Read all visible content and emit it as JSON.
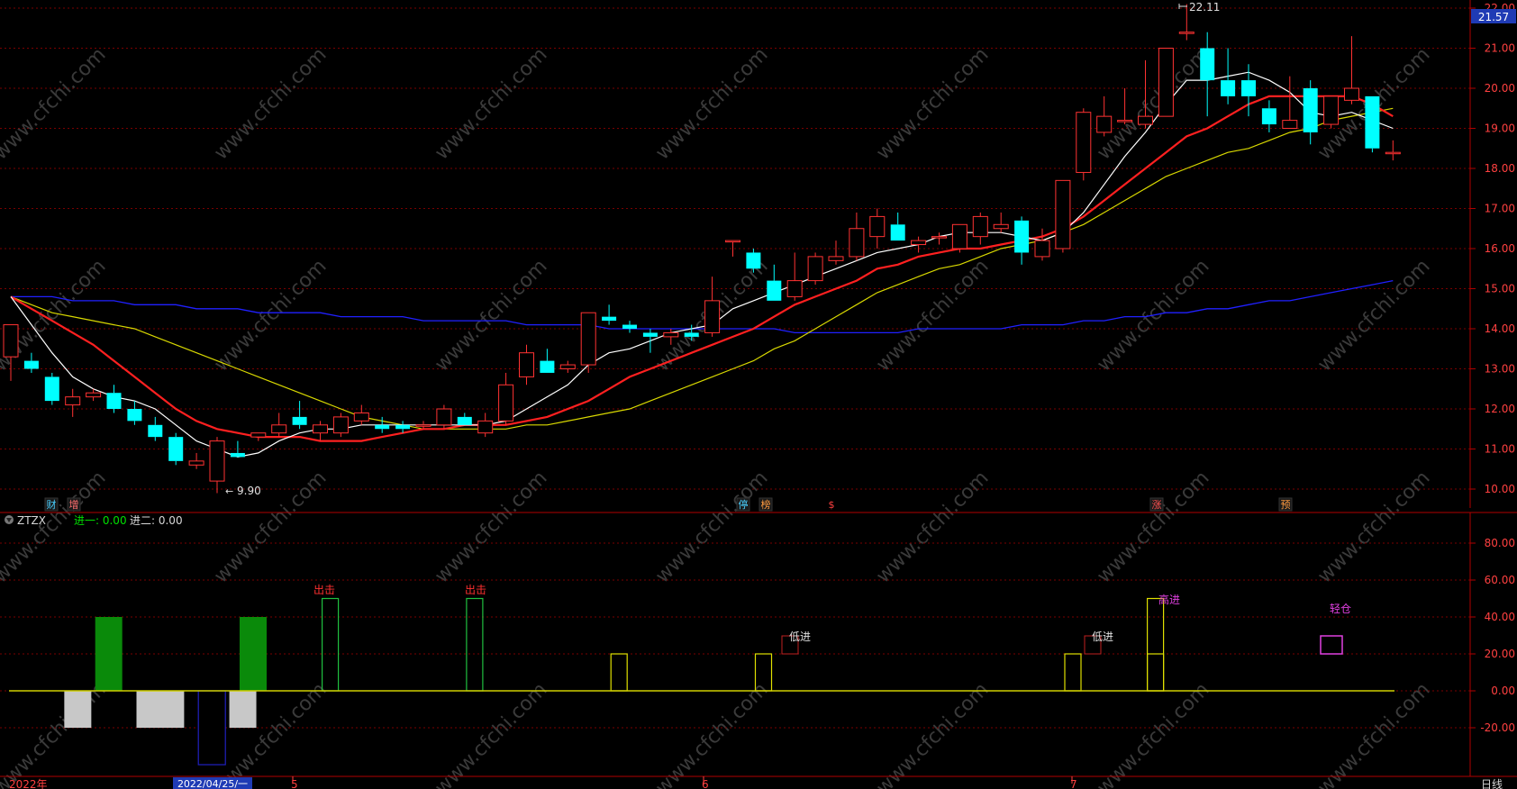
{
  "main_chart": {
    "price_axis_ticks": [
      "22.00",
      "21.00",
      "20.00",
      "19.00",
      "18.00",
      "17.00",
      "16.00",
      "15.00",
      "14.00",
      "13.00",
      "12.00",
      "11.00",
      "10.00"
    ],
    "current_price": "21.57",
    "high_marker": "22.11",
    "low_marker": "9.90",
    "event_tags": [
      "财",
      "增",
      "停",
      "榜",
      "$",
      "涨",
      "预"
    ]
  },
  "indicator": {
    "name": "ZTZX",
    "legend_1": "进一: 0.00",
    "legend_2": "进二: 0.00",
    "axis_ticks": [
      "80.00",
      "60.00",
      "40.00",
      "20.00",
      "0.00",
      "-20.00"
    ],
    "annotations": [
      "出击",
      "出击",
      "低进",
      "低进",
      "高进",
      "轻仓"
    ]
  },
  "time_axis": {
    "labels": [
      "2022年",
      "5",
      "6",
      "7"
    ],
    "cursor_date": "2022/04/25/一",
    "period": "日线"
  },
  "watermark": "www.cfchi.com",
  "colors": {
    "up": "#ff3232",
    "down": "#00ffff",
    "ma5": "#ffffff",
    "ma10": "#ff2020",
    "ma20": "#d8d800",
    "ma60": "#2020ff",
    "grid": "#7a0000"
  },
  "chart_data": {
    "type": "candlestick",
    "price_range": [
      9.7,
      22.1
    ],
    "candles": [
      {
        "o": 13.3,
        "h": 14.1,
        "l": 12.7,
        "c": 14.1
      },
      {
        "o": 13.2,
        "h": 13.4,
        "l": 12.9,
        "c": 13.0
      },
      {
        "o": 12.8,
        "h": 12.9,
        "l": 12.1,
        "c": 12.2
      },
      {
        "o": 12.1,
        "h": 12.5,
        "l": 11.8,
        "c": 12.3
      },
      {
        "o": 12.3,
        "h": 12.5,
        "l": 12.2,
        "c": 12.4
      },
      {
        "o": 12.4,
        "h": 12.6,
        "l": 11.9,
        "c": 12.0
      },
      {
        "o": 12.0,
        "h": 12.2,
        "l": 11.6,
        "c": 11.7
      },
      {
        "o": 11.6,
        "h": 11.8,
        "l": 11.2,
        "c": 11.3
      },
      {
        "o": 11.3,
        "h": 11.4,
        "l": 10.6,
        "c": 10.7
      },
      {
        "o": 10.6,
        "h": 10.9,
        "l": 10.5,
        "c": 10.7
      },
      {
        "o": 10.2,
        "h": 11.3,
        "l": 9.9,
        "c": 11.2
      },
      {
        "o": 10.9,
        "h": 11.2,
        "l": 10.8,
        "c": 10.8
      },
      {
        "o": 11.3,
        "h": 11.4,
        "l": 11.2,
        "c": 11.4
      },
      {
        "o": 11.4,
        "h": 11.9,
        "l": 11.3,
        "c": 11.6
      },
      {
        "o": 11.8,
        "h": 12.2,
        "l": 11.5,
        "c": 11.6
      },
      {
        "o": 11.4,
        "h": 11.7,
        "l": 11.2,
        "c": 11.6
      },
      {
        "o": 11.4,
        "h": 11.9,
        "l": 11.3,
        "c": 11.8
      },
      {
        "o": 11.7,
        "h": 12.1,
        "l": 11.6,
        "c": 11.9
      },
      {
        "o": 11.6,
        "h": 11.8,
        "l": 11.4,
        "c": 11.5
      },
      {
        "o": 11.6,
        "h": 11.7,
        "l": 11.4,
        "c": 11.5
      },
      {
        "o": 11.6,
        "h": 11.7,
        "l": 11.5,
        "c": 11.6
      },
      {
        "o": 11.6,
        "h": 12.1,
        "l": 11.5,
        "c": 12.0
      },
      {
        "o": 11.8,
        "h": 11.9,
        "l": 11.6,
        "c": 11.6
      },
      {
        "o": 11.4,
        "h": 11.9,
        "l": 11.3,
        "c": 11.7
      },
      {
        "o": 11.7,
        "h": 12.9,
        "l": 11.6,
        "c": 12.6
      },
      {
        "o": 12.8,
        "h": 13.6,
        "l": 12.6,
        "c": 13.4
      },
      {
        "o": 13.2,
        "h": 13.5,
        "l": 12.9,
        "c": 12.9
      },
      {
        "o": 13.0,
        "h": 13.2,
        "l": 12.9,
        "c": 13.1
      },
      {
        "o": 13.1,
        "h": 14.4,
        "l": 12.9,
        "c": 14.4
      },
      {
        "o": 14.3,
        "h": 14.6,
        "l": 14.1,
        "c": 14.2
      },
      {
        "o": 14.1,
        "h": 14.2,
        "l": 13.9,
        "c": 14.0
      },
      {
        "o": 13.9,
        "h": 14.0,
        "l": 13.4,
        "c": 13.8
      },
      {
        "o": 13.8,
        "h": 14.0,
        "l": 13.6,
        "c": 13.9
      },
      {
        "o": 13.9,
        "h": 14.1,
        "l": 13.7,
        "c": 13.8
      },
      {
        "o": 13.9,
        "h": 15.3,
        "l": 13.8,
        "c": 14.7
      },
      {
        "o": 16.2,
        "h": 16.2,
        "l": 15.8,
        "c": 16.2
      },
      {
        "o": 15.9,
        "h": 16.0,
        "l": 15.4,
        "c": 15.5
      },
      {
        "o": 15.2,
        "h": 15.6,
        "l": 14.7,
        "c": 14.7
      },
      {
        "o": 14.8,
        "h": 15.9,
        "l": 14.7,
        "c": 15.2
      },
      {
        "o": 15.2,
        "h": 15.9,
        "l": 15.1,
        "c": 15.8
      },
      {
        "o": 15.7,
        "h": 16.2,
        "l": 15.6,
        "c": 15.8
      },
      {
        "o": 15.8,
        "h": 16.9,
        "l": 15.7,
        "c": 16.5
      },
      {
        "o": 16.3,
        "h": 17.0,
        "l": 16.0,
        "c": 16.8
      },
      {
        "o": 16.6,
        "h": 16.9,
        "l": 16.2,
        "c": 16.2
      },
      {
        "o": 16.1,
        "h": 16.3,
        "l": 15.9,
        "c": 16.2
      },
      {
        "o": 16.3,
        "h": 16.4,
        "l": 16.1,
        "c": 16.3
      },
      {
        "o": 16.0,
        "h": 16.6,
        "l": 15.9,
        "c": 16.6
      },
      {
        "o": 16.3,
        "h": 16.9,
        "l": 16.1,
        "c": 16.8
      },
      {
        "o": 16.5,
        "h": 16.9,
        "l": 16.4,
        "c": 16.6
      },
      {
        "o": 16.7,
        "h": 16.8,
        "l": 15.6,
        "c": 15.9
      },
      {
        "o": 15.8,
        "h": 16.5,
        "l": 15.7,
        "c": 16.2
      },
      {
        "o": 16.0,
        "h": 17.7,
        "l": 15.9,
        "c": 17.7
      },
      {
        "o": 17.9,
        "h": 19.5,
        "l": 17.7,
        "c": 19.4
      },
      {
        "o": 18.9,
        "h": 19.8,
        "l": 18.8,
        "c": 19.3
      },
      {
        "o": 19.2,
        "h": 20.0,
        "l": 19.1,
        "c": 19.2
      },
      {
        "o": 19.1,
        "h": 20.7,
        "l": 19.0,
        "c": 19.3
      },
      {
        "o": 19.3,
        "h": 21.0,
        "l": 19.3,
        "c": 21.0
      },
      {
        "o": 21.4,
        "h": 22.1,
        "l": 21.2,
        "c": 21.4
      },
      {
        "o": 21.0,
        "h": 21.4,
        "l": 19.3,
        "c": 20.2
      },
      {
        "o": 20.2,
        "h": 21.0,
        "l": 19.6,
        "c": 19.8
      },
      {
        "o": 20.2,
        "h": 20.6,
        "l": 19.3,
        "c": 19.8
      },
      {
        "o": 19.5,
        "h": 19.7,
        "l": 18.9,
        "c": 19.1
      },
      {
        "o": 19.0,
        "h": 20.3,
        "l": 19.0,
        "c": 19.2
      },
      {
        "o": 20.0,
        "h": 20.2,
        "l": 18.6,
        "c": 18.9
      },
      {
        "o": 19.1,
        "h": 19.8,
        "l": 19.0,
        "c": 19.8
      },
      {
        "o": 19.7,
        "h": 21.3,
        "l": 19.6,
        "c": 20.0
      },
      {
        "o": 19.8,
        "h": 19.8,
        "l": 18.4,
        "c": 18.5
      },
      {
        "o": 18.4,
        "h": 18.7,
        "l": 18.2,
        "c": 18.4
      }
    ],
    "ma5": [
      14.8,
      14.1,
      13.4,
      12.8,
      12.5,
      12.3,
      12.2,
      12.0,
      11.6,
      11.2,
      11.0,
      10.8,
      10.9,
      11.2,
      11.4,
      11.5,
      11.5,
      11.6,
      11.6,
      11.6,
      11.6,
      11.6,
      11.6,
      11.6,
      11.7,
      12.0,
      12.3,
      12.6,
      13.1,
      13.4,
      13.5,
      13.7,
      13.9,
      14.0,
      14.1,
      14.5,
      14.7,
      14.9,
      15.1,
      15.3,
      15.5,
      15.7,
      15.9,
      16.0,
      16.1,
      16.3,
      16.4,
      16.4,
      16.4,
      16.3,
      16.2,
      16.4,
      16.9,
      17.6,
      18.3,
      18.9,
      19.6,
      20.2,
      20.2,
      20.3,
      20.4,
      20.2,
      19.9,
      19.4,
      19.3,
      19.4,
      19.2,
      19.0
    ],
    "ma10": [
      14.8,
      14.5,
      14.2,
      13.9,
      13.6,
      13.2,
      12.8,
      12.4,
      12.0,
      11.7,
      11.5,
      11.4,
      11.3,
      11.3,
      11.3,
      11.2,
      11.2,
      11.2,
      11.3,
      11.4,
      11.5,
      11.5,
      11.6,
      11.6,
      11.6,
      11.7,
      11.8,
      12.0,
      12.2,
      12.5,
      12.8,
      13.0,
      13.2,
      13.4,
      13.6,
      13.8,
      14.0,
      14.3,
      14.6,
      14.8,
      15.0,
      15.2,
      15.5,
      15.6,
      15.8,
      15.9,
      16.0,
      16.0,
      16.1,
      16.2,
      16.3,
      16.5,
      16.8,
      17.2,
      17.6,
      18.0,
      18.4,
      18.8,
      19.0,
      19.3,
      19.6,
      19.8,
      19.8,
      19.8,
      19.8,
      19.8,
      19.6,
      19.3
    ],
    "ma20": [
      14.8,
      14.6,
      14.4,
      14.3,
      14.2,
      14.1,
      14.0,
      13.8,
      13.6,
      13.4,
      13.2,
      13.0,
      12.8,
      12.6,
      12.4,
      12.2,
      12.0,
      11.8,
      11.7,
      11.6,
      11.5,
      11.5,
      11.5,
      11.5,
      11.5,
      11.6,
      11.6,
      11.7,
      11.8,
      11.9,
      12.0,
      12.2,
      12.4,
      12.6,
      12.8,
      13.0,
      13.2,
      13.5,
      13.7,
      14.0,
      14.3,
      14.6,
      14.9,
      15.1,
      15.3,
      15.5,
      15.6,
      15.8,
      16.0,
      16.1,
      16.2,
      16.4,
      16.6,
      16.9,
      17.2,
      17.5,
      17.8,
      18.0,
      18.2,
      18.4,
      18.5,
      18.7,
      18.9,
      19.0,
      19.2,
      19.3,
      19.4,
      19.5
    ],
    "ma60": [
      14.8,
      14.8,
      14.8,
      14.7,
      14.7,
      14.7,
      14.6,
      14.6,
      14.6,
      14.5,
      14.5,
      14.5,
      14.4,
      14.4,
      14.4,
      14.4,
      14.3,
      14.3,
      14.3,
      14.3,
      14.2,
      14.2,
      14.2,
      14.2,
      14.2,
      14.1,
      14.1,
      14.1,
      14.1,
      14.0,
      14.0,
      14.0,
      14.0,
      14.0,
      14.0,
      14.0,
      14.0,
      14.0,
      13.9,
      13.9,
      13.9,
      13.9,
      13.9,
      13.9,
      14.0,
      14.0,
      14.0,
      14.0,
      14.0,
      14.1,
      14.1,
      14.1,
      14.2,
      14.2,
      14.3,
      14.3,
      14.4,
      14.4,
      14.5,
      14.5,
      14.6,
      14.7,
      14.7,
      14.8,
      14.9,
      15.0,
      15.1,
      15.2
    ],
    "indicator_bars": [
      {
        "i": 1.5,
        "v": -20,
        "color": "gray"
      },
      {
        "i": 3,
        "v": 40,
        "color": "green"
      },
      {
        "i": 5,
        "v": -20,
        "color": "gray"
      },
      {
        "i": 6,
        "v": -20,
        "color": "gray"
      },
      {
        "i": 8,
        "v": -40,
        "color": "navy"
      },
      {
        "i": 9.5,
        "v": -20,
        "color": "gray"
      },
      {
        "i": 10,
        "v": 40,
        "color": "green"
      },
      {
        "i": 14,
        "v": 50,
        "color": "green_outline"
      },
      {
        "i": 21,
        "v": 50,
        "color": "green_outline"
      },
      {
        "i": 28,
        "v": 20,
        "color": "yellow_outline"
      },
      {
        "i": 35,
        "v": 20,
        "color": "yellow_outline"
      },
      {
        "i": 50,
        "v": 20,
        "color": "yellow_outline"
      },
      {
        "i": 54,
        "v": 20,
        "color": "yellow_outline"
      },
      {
        "i": 54,
        "v": 50,
        "color": "yellow_outline"
      }
    ]
  }
}
